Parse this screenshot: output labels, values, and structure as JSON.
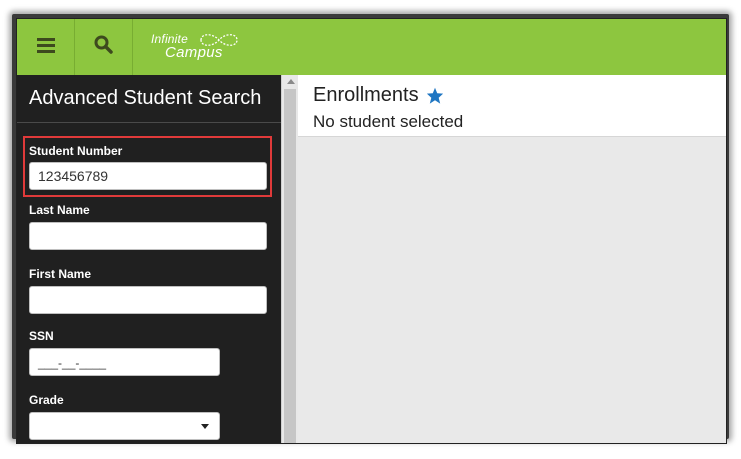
{
  "app": {
    "logo_line1": "Infinite",
    "logo_line2": "Campus",
    "brand_color": "#8dc63f"
  },
  "toolbar": {
    "menu_icon": "hamburger-menu-icon",
    "search_icon": "search-icon"
  },
  "sidebar": {
    "title": "Advanced Student Search",
    "fields": {
      "student_number": {
        "label": "Student Number",
        "value": "123456789"
      },
      "last_name": {
        "label": "Last Name",
        "value": ""
      },
      "first_name": {
        "label": "First Name",
        "value": ""
      },
      "ssn": {
        "label": "SSN",
        "value": "___-__-____"
      },
      "grade": {
        "label": "Grade",
        "value": ""
      }
    },
    "highlight_color": "#e03a3a"
  },
  "main": {
    "title": "Enrollments",
    "subtitle": "No student selected",
    "star_icon": "star-icon",
    "star_color": "#1f76c2"
  }
}
